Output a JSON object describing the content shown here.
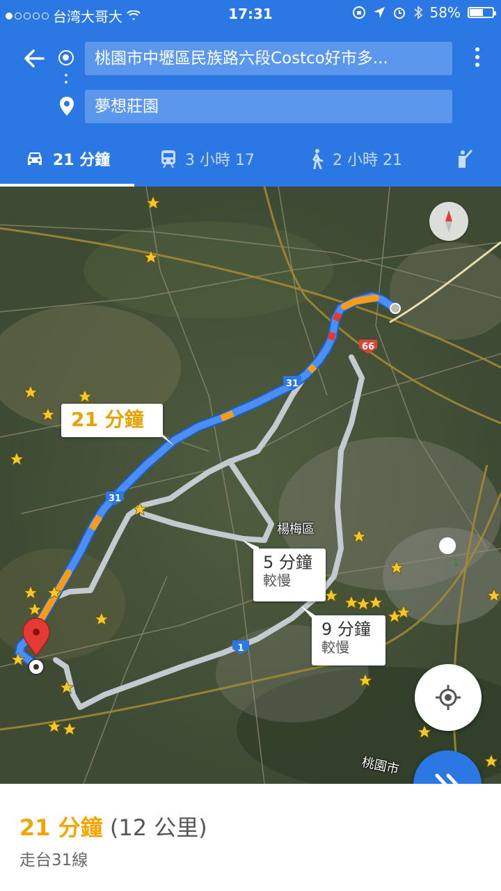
{
  "status_bar": {
    "carrier": "台湾大哥大",
    "time": "17:31",
    "battery": "58%",
    "battery_level": 0.58
  },
  "search": {
    "origin": "桃園市中壢區民族路六段Costco好市多...",
    "destination": "夢想莊園"
  },
  "modes": [
    {
      "icon": "car-icon",
      "label": "21 分鐘"
    },
    {
      "icon": "train-icon",
      "label": "3 小時 17"
    },
    {
      "icon": "walk-icon",
      "label": "2 小時 21"
    },
    {
      "icon": "ride-icon",
      "label": ""
    }
  ],
  "map": {
    "route_callouts": [
      {
        "time": "21 分鐘",
        "note": ""
      },
      {
        "time": "5 分鐘",
        "note": "較慢"
      },
      {
        "time": "9 分鐘",
        "note": "較慢"
      }
    ],
    "place_labels": [
      "楊梅區",
      "桃園市"
    ],
    "road_shields": [
      "31",
      "31",
      "66",
      "1",
      "1"
    ]
  },
  "summary": {
    "time": "21 分鐘",
    "distance": "(12 公里)",
    "via": "走台31線"
  },
  "colors": {
    "brand_blue": "#2b78e4",
    "route_blue": "#4d8ef5",
    "alt_route_gray": "#bfc6cc",
    "traffic_orange": "#f59c1a",
    "time_yellow": "#f2a600"
  }
}
